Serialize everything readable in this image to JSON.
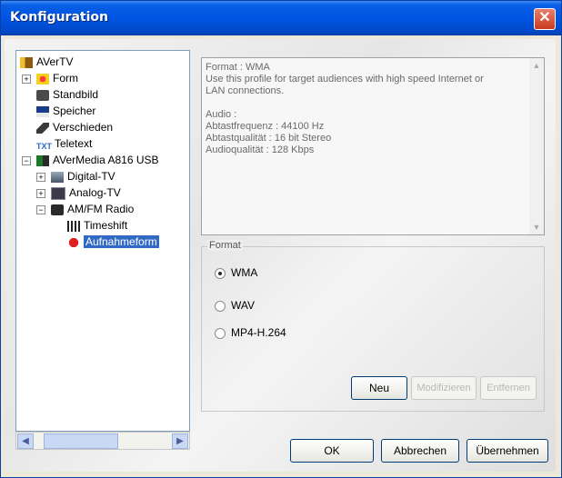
{
  "window": {
    "title": "Konfiguration"
  },
  "tree": {
    "items": [
      {
        "label": "AVerTV"
      },
      {
        "label": "Form"
      },
      {
        "label": "Standbild"
      },
      {
        "label": "Speicher"
      },
      {
        "label": "Verschieden"
      },
      {
        "label": "Teletext"
      },
      {
        "label": "AVerMedia A816 USB"
      },
      {
        "label": "Digital-TV"
      },
      {
        "label": "Analog-TV"
      },
      {
        "label": "AM/FM Radio"
      },
      {
        "label": "Timeshift"
      },
      {
        "label": "Aufnahmeform"
      }
    ],
    "selected": "Aufnahmeform"
  },
  "description": {
    "text": "Format : WMA\nUse this profile for target audiences with high speed Internet or\nLAN connections.\n\nAudio :\nAbtastfrequenz : 44100 Hz\nAbtastqualität : 16 bit Stereo\nAudioqualität : 128 Kbps"
  },
  "format_group": {
    "legend": "Format",
    "options": [
      {
        "label": "WMA",
        "checked": true
      },
      {
        "label": "WAV",
        "checked": false
      },
      {
        "label": "MP4-H.264",
        "checked": false
      }
    ],
    "new_label": "Neu",
    "modify_label": "Modifizieren",
    "remove_label": "Entfernen"
  },
  "footer": {
    "ok_label": "OK",
    "cancel_label": "Abbrechen",
    "apply_label": "Übernehmen"
  }
}
